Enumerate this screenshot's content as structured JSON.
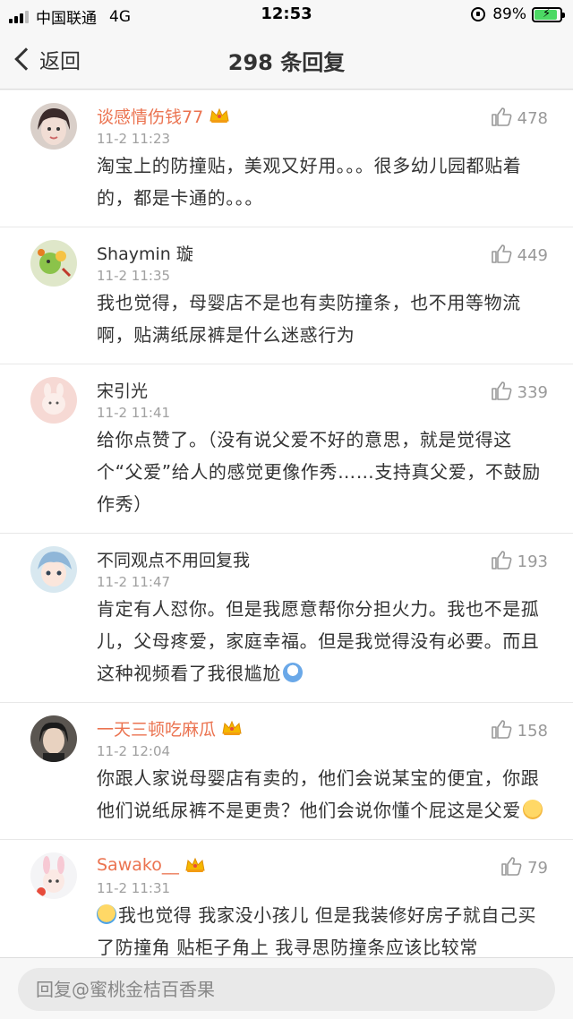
{
  "status_bar": {
    "carrier": "中国联通",
    "network": "4G",
    "time": "12:53",
    "battery_text": "89%",
    "battery_level": 0.89
  },
  "nav": {
    "back_label": "返回",
    "title": "298 条回复"
  },
  "comments": [
    {
      "username": "谈感情伤钱77",
      "vip": true,
      "time": "11-2 11:23",
      "likes": "478",
      "text": "淘宝上的防撞贴，美观又好用。。。很多幼儿园都贴着的，都是卡通的。。。",
      "avatar": "girl-portrait-avatar"
    },
    {
      "username": "Shaymin 璇",
      "vip": false,
      "time": "11-2 11:35",
      "likes": "449",
      "text": "我也觉得，母婴店不是也有卖防撞条，也不用等物流啊，贴满纸尿裤是什么迷惑行为",
      "avatar": "cartoon-avatar"
    },
    {
      "username": "宋引光",
      "vip": false,
      "time": "11-2 11:41",
      "likes": "339",
      "text": "给你点赞了。（没有说父爱不好的意思，就是觉得这个“父爱”给人的感觉更像作秀……支持真父爱，不鼓励作秀）",
      "avatar": "pink-bunny-avatar"
    },
    {
      "username": "不同观点不用回复我",
      "vip": false,
      "time": "11-2 11:47",
      "likes": "193",
      "text": "肯定有人怼你。但是我愿意帮你分担火力。我也不是孤儿，父母疼爱，家庭幸福。但是我觉得没有必要。而且这种视频看了我很尴尬",
      "emoji": "awkward-emoji",
      "avatar": "anime-girl-avatar"
    },
    {
      "username": "一天三顿吃麻瓜",
      "vip": true,
      "time": "11-2 12:04",
      "likes": "158",
      "text": "你跟人家说母婴店有卖的，他们会说某宝的便宜，你跟他们说纸尿裤不是更贵？他们会说你懂个屁这是父爱",
      "emoji": "blush-emoji",
      "avatar": "dark-haired-man-avatar"
    },
    {
      "username": "Sawako__",
      "vip": true,
      "time": "11-2 11:31",
      "likes": "79",
      "text": "我也觉得 我家没小孩儿 但是我装修好房子就自己买了防撞角 贴柜子角上 我寻思防撞条应该比较常",
      "lead_emoji": "laugh-cry-emoji",
      "avatar": "bunny-ear-girl-avatar"
    }
  ],
  "reply_bar": {
    "placeholder": "回复@蜜桃金桔百香果"
  },
  "colors": {
    "vip_name": "#eb7350",
    "text": "#333333",
    "meta": "#a0a0a0",
    "battery": "#4cd964"
  }
}
